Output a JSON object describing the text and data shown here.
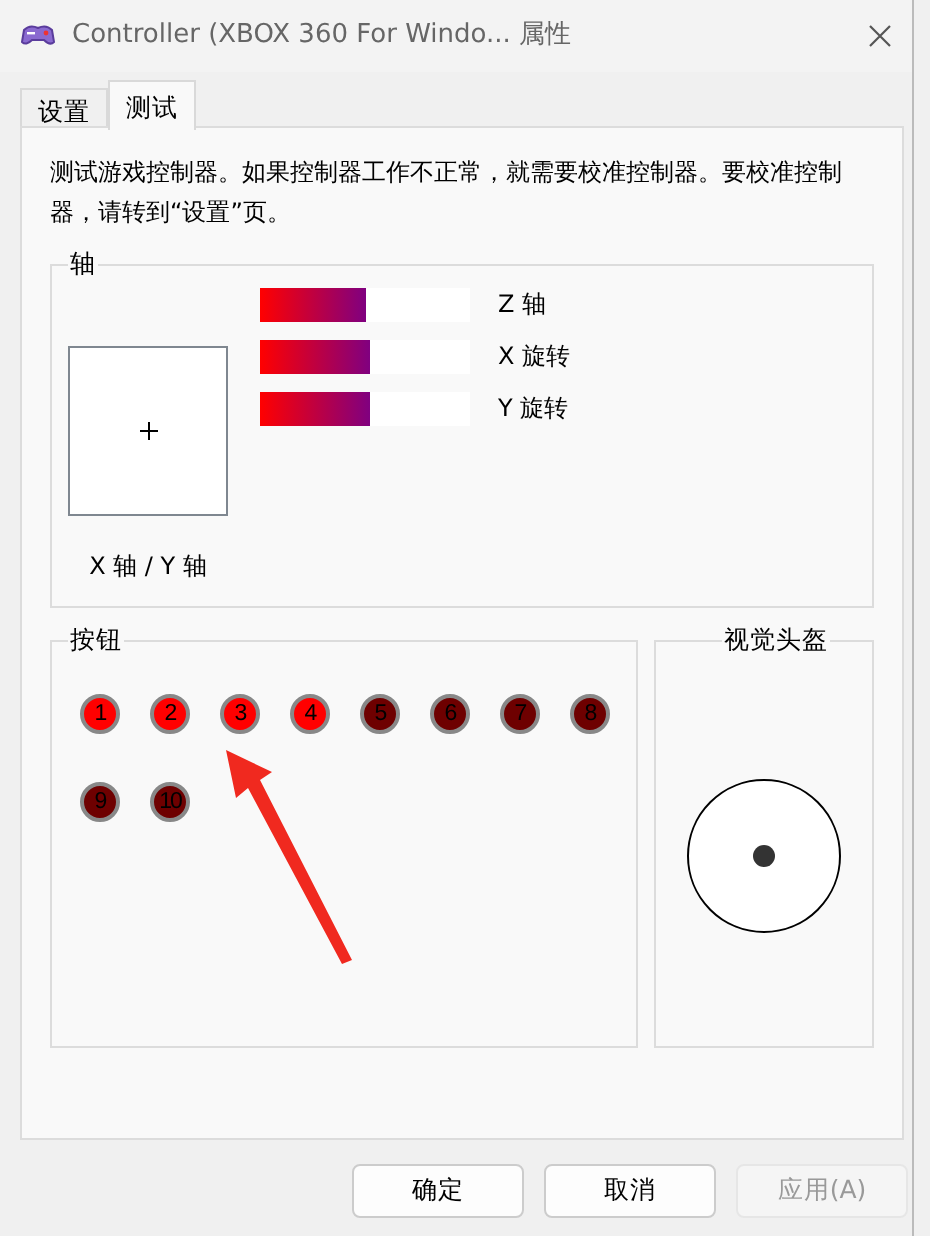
{
  "window": {
    "title": "Controller (XBOX 360 For Windo... 属性"
  },
  "tabs": [
    {
      "label": "设置",
      "selected": false
    },
    {
      "label": "测试",
      "selected": true
    }
  ],
  "description": "测试游戏控制器。如果控制器工作不正常，就需要校准控制器。要校准控制器，请转到“设置”页。",
  "axes": {
    "title": "轴",
    "xy_label": "X 轴 / Y 轴",
    "bars": [
      {
        "label": "Z 轴",
        "level": 0.5
      },
      {
        "label": "X 旋转",
        "level": 0.52
      },
      {
        "label": "Y 旋转",
        "level": 0.52
      }
    ]
  },
  "buttons_group": {
    "title": "按钮",
    "buttons": [
      {
        "label": "1",
        "pressed": true
      },
      {
        "label": "2",
        "pressed": true
      },
      {
        "label": "3",
        "pressed": true
      },
      {
        "label": "4",
        "pressed": true
      },
      {
        "label": "5",
        "pressed": false
      },
      {
        "label": "6",
        "pressed": false
      },
      {
        "label": "7",
        "pressed": false
      },
      {
        "label": "8",
        "pressed": false
      },
      {
        "label": "9",
        "pressed": false
      },
      {
        "label": "10",
        "pressed": false
      }
    ]
  },
  "pov": {
    "title": "视觉头盔"
  },
  "dialog_buttons": [
    {
      "label": "确定",
      "disabled": false
    },
    {
      "label": "取消",
      "disabled": false
    },
    {
      "label": "应用(A)",
      "disabled": true
    }
  ]
}
